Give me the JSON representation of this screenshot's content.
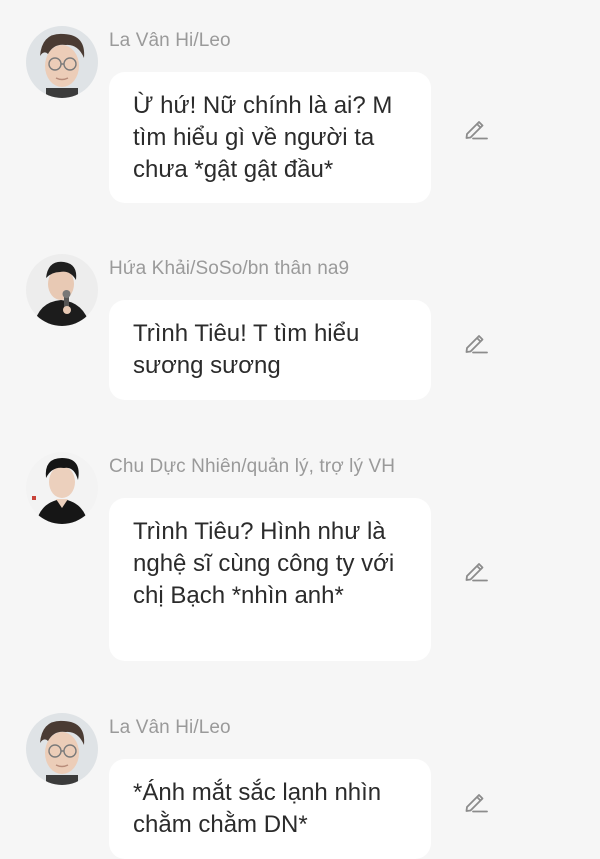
{
  "messages": [
    {
      "sender": "La Vân Hi/Leo",
      "text": "Ừ hứ! Nữ chính là ai? M tìm hiểu gì về người ta chưa *gật gật đầu*",
      "avatar_icon": "avatar-glasses-icon"
    },
    {
      "sender": "Hứa Khải/SoSo/bn thân na9",
      "text": "Trình Tiêu! T tìm hiểu sương sương",
      "avatar_icon": "avatar-microphone-icon"
    },
    {
      "sender": "Chu Dực Nhiên/quản lý, trợ lý VH",
      "text": "Trình Tiêu? Hình như là nghệ sĩ cùng công ty với chị Bạch *nhìn anh*",
      "avatar_icon": "avatar-dark-shirt-icon"
    },
    {
      "sender": "La Vân Hi/Leo",
      "text": "*Ánh mắt sắc lạnh nhìn chằm chằm DN*",
      "avatar_icon": "avatar-glasses-icon"
    }
  ],
  "edit_icon": "pencil-edit-icon",
  "colors": {
    "background": "#f6f6f6",
    "bubble": "#ffffff",
    "name": "#9a9a9a",
    "text": "#2b2b2b",
    "icon": "#8c8c8c"
  }
}
